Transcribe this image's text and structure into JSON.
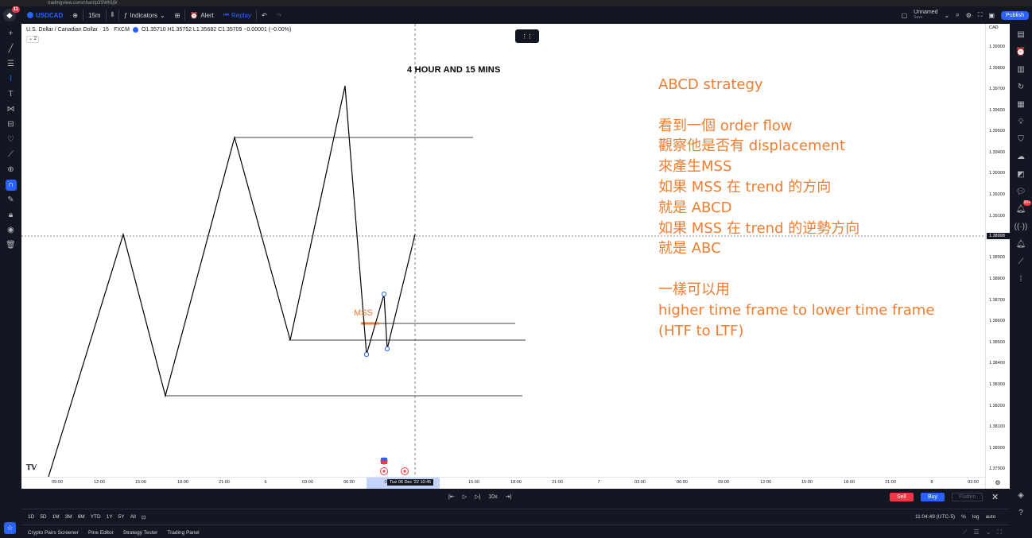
{
  "browser": {
    "url": "tradingview.com/chart/p3SWKlj9/"
  },
  "toolbar": {
    "logo_badge": "11",
    "symbol": "USDCAD",
    "interval": "15m",
    "indicators_label": "Indicators",
    "alert_label": "Alert",
    "replay_label": "Replay",
    "layout_name": "Unnamed",
    "layout_status": "Save",
    "publish_label": "Publish"
  },
  "legend": {
    "title": "U.S. Dollar / Canadian Dollar · 15 · FXCM",
    "ohlc": "O1.35710 H1.35752 L1.35682 C1.35709 −0.00001 (−0.00%)",
    "collapsed_count": "2"
  },
  "chart": {
    "heading": "4 HOUR AND 15 MINS",
    "mss_label": "MSS",
    "notes": [
      "ABCD strategy",
      "",
      "看到一個 order flow",
      "觀察他是否有 displacement",
      "來產生MSS",
      "如果 MSS 在 trend 的方向",
      "就是 ABCD",
      "如果 MSS 在 trend 的逆勢方向",
      "就是 ABC",
      "",
      "一樣可以用",
      "higher time frame to lower time frame",
      "(HTF to LTF)"
    ],
    "line_color": "#000000",
    "accent_color": "#f07d2f"
  },
  "price_axis": {
    "currency": "CAD",
    "ticks": [
      "1.39900",
      "1.39800",
      "1.39700",
      "1.39600",
      "1.39500",
      "1.39400",
      "1.39300",
      "1.39200",
      "1.39100",
      "1.38900",
      "1.38800",
      "1.38700",
      "1.38600",
      "1.38500",
      "1.38400",
      "1.38300",
      "1.38200",
      "1.38100",
      "1.38000",
      "1.37900"
    ],
    "current": "1.38998"
  },
  "time_axis": {
    "ticks": [
      "09:00",
      "12:00",
      "15:00",
      "18:00",
      "21:00",
      "6",
      "03:00",
      "06:00",
      "0",
      "15:00",
      "18:00",
      "21:00",
      "7",
      "03:00",
      "06:00",
      "09:00",
      "12:00",
      "15:00",
      "18:00",
      "21:00",
      "8",
      "03:00"
    ],
    "crosshair_label": "Tue 06 Dec '22   10:45"
  },
  "replay": {
    "speed": "10x",
    "sell_label": "Sell",
    "buy_label": "Buy",
    "flatten_label": "Flatten"
  },
  "range_bar": {
    "ranges": [
      "1D",
      "5D",
      "1M",
      "3M",
      "6M",
      "YTD",
      "1Y",
      "5Y",
      "All"
    ],
    "clock": "11:04:49 (UTC-5)",
    "percent": "%",
    "log": "log",
    "auto": "auto"
  },
  "bottom_tabs": [
    "Crypto Pairs Screener",
    "Pine Editor",
    "Strategy Tester",
    "Trading Panel"
  ],
  "right_toolbar_badge": "99+"
}
